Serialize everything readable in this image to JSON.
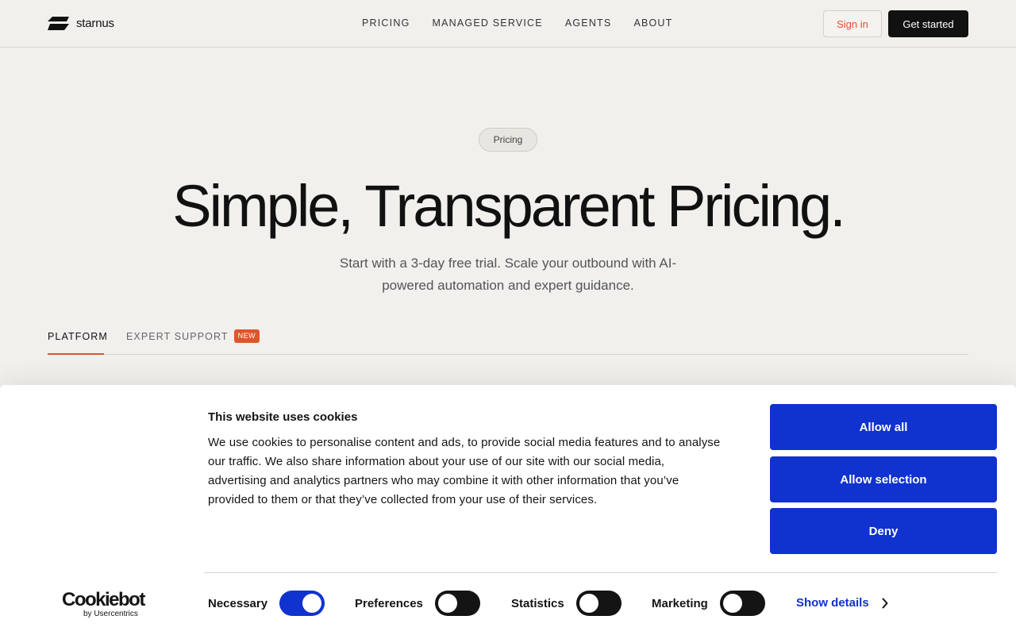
{
  "header": {
    "brand": "starnus",
    "nav": [
      "PRICING",
      "MANAGED SERVICE",
      "AGENTS",
      "ABOUT"
    ],
    "signin_label": "Sign in",
    "getstarted_label": "Get started",
    "accent_color": "#e0552b"
  },
  "hero": {
    "pill": "Pricing",
    "title": "Simple, Transparent Pricing.",
    "subtitle": "Start with a 3-day free trial. Scale your outbound with AI-powered automation and expert guidance."
  },
  "tabs": {
    "platform": "PLATFORM",
    "expert": "EXPERT SUPPORT",
    "expert_badge": "NEW"
  },
  "cookie": {
    "title": "This website uses cookies",
    "body": "We use cookies to personalise content and ads, to provide social media features and to analyse our traffic. We also share information about your use of our site with our social media, advertising and analytics partners who may combine it with other information that you’ve provided to them or that they’ve collected from your use of their services.",
    "allow_all": "Allow all",
    "allow_selection": "Allow selection",
    "deny": "Deny",
    "brand_main": "Cookiebot",
    "brand_sub": "by Usercentrics",
    "toggles": [
      {
        "label": "Necessary",
        "on": true
      },
      {
        "label": "Preferences",
        "on": false
      },
      {
        "label": "Statistics",
        "on": false
      },
      {
        "label": "Marketing",
        "on": false
      }
    ],
    "show_details": "Show details",
    "button_color": "#1032cf"
  }
}
